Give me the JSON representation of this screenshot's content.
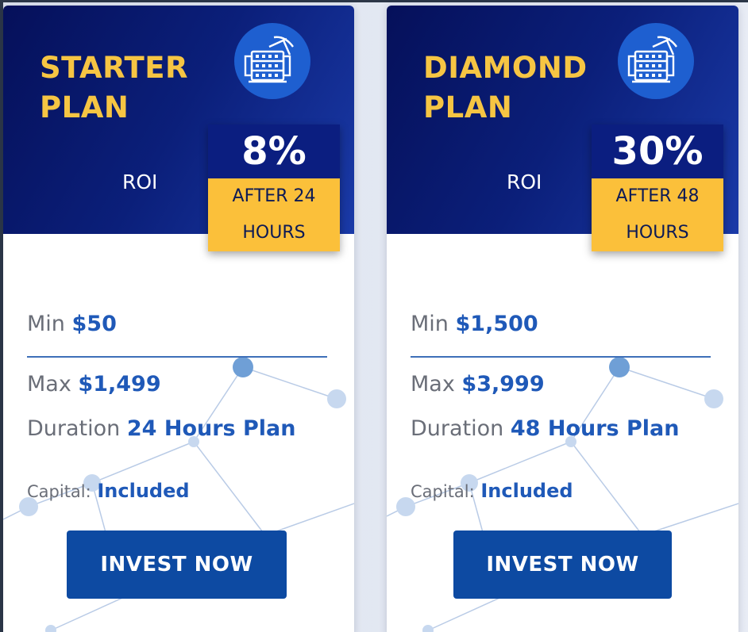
{
  "plans": [
    {
      "name": "STARTER\nPLAN",
      "roi_label": "ROI",
      "roi_percent": "8%",
      "roi_after": "AFTER 24 HOURS",
      "min_label": "Min",
      "min_value": "$50",
      "max_label": "Max",
      "max_value": "$1,499",
      "duration_label": "Duration",
      "duration_value": "24 Hours Plan",
      "capital_label": "Capital:",
      "capital_value": "Included",
      "button_label": "INVEST NOW"
    },
    {
      "name": "DIAMOND\nPLAN",
      "roi_label": "ROI",
      "roi_percent": "30%",
      "roi_after": "AFTER 48 HOURS",
      "min_label": "Min",
      "min_value": "$1,500",
      "max_label": "Max",
      "max_value": "$3,999",
      "duration_label": "Duration",
      "duration_value": "48 Hours Plan",
      "capital_label": "Capital:",
      "capital_value": "Included",
      "button_label": "INVEST NOW"
    }
  ],
  "colors": {
    "header_dark": "#05105a",
    "accent_yellow": "#f6c543",
    "roi_box_blue": "#0b1e80",
    "value_blue": "#1f59b8",
    "button_blue": "#0d4aa2"
  },
  "icons": {
    "plan_icon": "mining-server-icon"
  }
}
